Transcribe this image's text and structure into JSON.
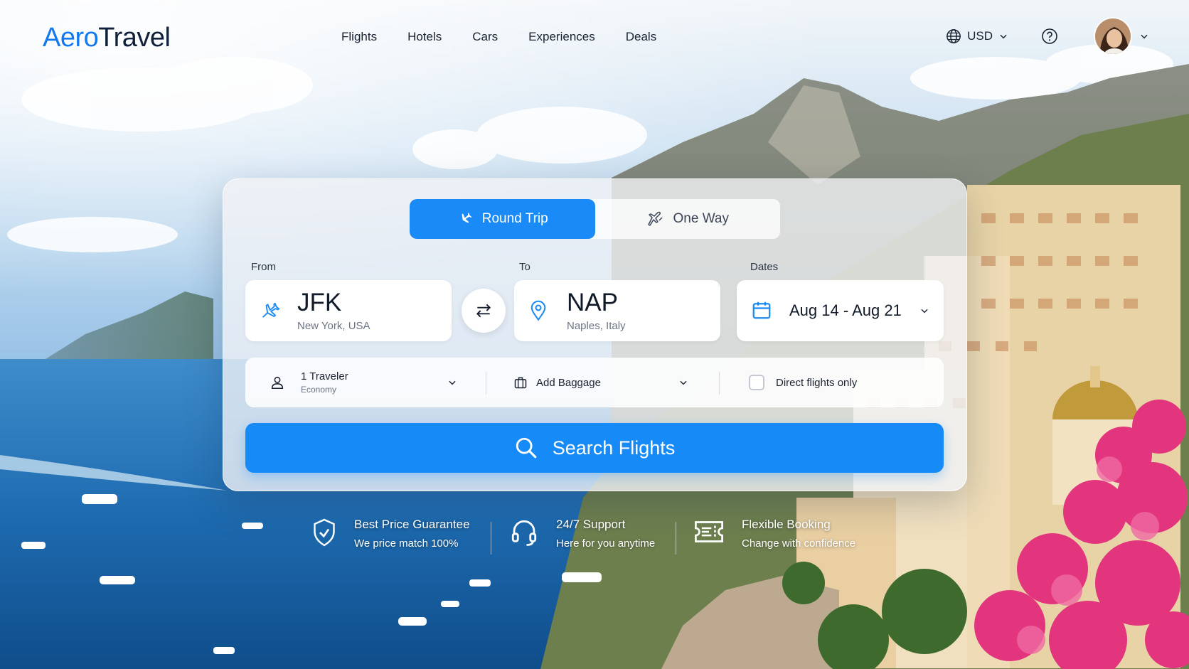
{
  "brand": {
    "part1": "Aero",
    "part2": "Travel"
  },
  "nav": {
    "items": [
      "Flights",
      "Hotels",
      "Cars",
      "Experiences",
      "Deals"
    ]
  },
  "header": {
    "currency": "USD"
  },
  "trip_type": {
    "options": [
      "Round Trip",
      "One Way"
    ],
    "selected": "Round Trip"
  },
  "from": {
    "label": "From",
    "code": "JFK",
    "city": "New York, USA"
  },
  "to": {
    "label": "To",
    "code": "NAP",
    "city": "Naples, Italy"
  },
  "dates": {
    "label": "Dates",
    "value": "Aug 14 - Aug 21"
  },
  "travelers": {
    "main": "1 Traveler",
    "cabin": "Economy"
  },
  "baggage": {
    "label": "Add Baggage"
  },
  "direct": {
    "label": "Direct flights only",
    "checked": false
  },
  "search": {
    "label": "Search Flights"
  },
  "features": [
    {
      "title": "Best Price Guarantee",
      "subtitle": "We price match 100%",
      "icon": "shield-check-icon"
    },
    {
      "title": "24/7 Support",
      "subtitle": "Here for you anytime",
      "icon": "headset-icon"
    },
    {
      "title": "Flexible Booking",
      "subtitle": "Change with confidence",
      "icon": "ticket-icon"
    }
  ],
  "colors": {
    "accent": "#168bf7",
    "brand_blue": "#1479f0",
    "brand_dark": "#10203a"
  }
}
